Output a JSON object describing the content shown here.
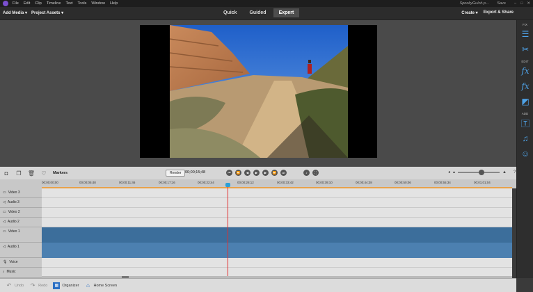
{
  "menubar": {
    "items": [
      "File",
      "Edit",
      "Clip",
      "Timeline",
      "Text",
      "Tools",
      "Window",
      "Help"
    ],
    "project_name": "SpookyGulch.p...",
    "save_label": "Save"
  },
  "toolbar": {
    "add_media": "Add Media ▾",
    "project_assets": "Project Assets ▾",
    "modes": [
      "Quick",
      "Guided",
      "Expert"
    ],
    "active_mode": "Expert",
    "create": "Create ▾",
    "export_share": "Export & Share"
  },
  "right_panel": {
    "sections": [
      "FIX",
      "EDIT",
      "ADD"
    ]
  },
  "timeline_toolbar": {
    "markers_label": "Markers",
    "render_label": "Render",
    "timecode": "00;00;15;48"
  },
  "ruler": {
    "labels": [
      "00;00;00;00",
      "00;00;05;48",
      "00;00;11;46",
      "00;00;17;16",
      "00;00;22;44",
      "00;00;28;12",
      "00;00;33;42",
      "00;00;39;10",
      "00;00;44;38",
      "00;00;50;06",
      "00;00;55;34",
      "00;01;01;04"
    ]
  },
  "tracks": [
    "Video 3",
    "Audio 3",
    "Video 2",
    "Audio 2",
    "Video 1",
    "Audio 1",
    "Voice",
    "Music"
  ],
  "statusbar": {
    "undo": "Undo",
    "redo": "Redo",
    "organizer": "Organizer",
    "home_screen": "Home Screen"
  },
  "colors": {
    "accent": "#2a9fd6",
    "playhead": "#e03030",
    "clip": "#3c6e9b"
  }
}
